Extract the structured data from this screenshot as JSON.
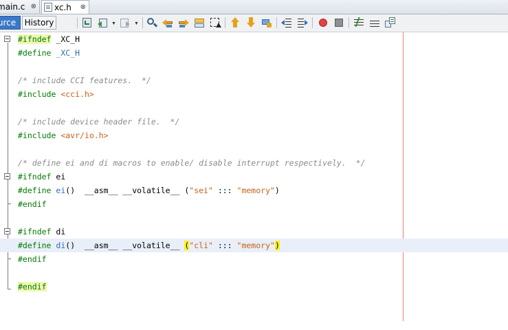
{
  "tabs": [
    {
      "label": "main.c",
      "active": false,
      "close": "⊗"
    },
    {
      "label": "xc.h",
      "active": true,
      "close": "⊗"
    }
  ],
  "toolbar": {
    "source_label": "Source",
    "source_visible": "urce",
    "history_label": "History",
    "icons": [
      "last-edit-icon",
      "back-icon",
      "forward-icon",
      "find-icon",
      "find-previous-icon",
      "find-next-icon",
      "toggle-highlight-icon",
      "toggle-rectangular-selection-icon",
      "previous-bookmark-icon",
      "next-bookmark-icon",
      "toggle-bookmark-icon",
      "shift-left-icon",
      "shift-right-icon",
      "record-macro-icon",
      "stop-macro-icon",
      "comment-icon",
      "uncomment-icon",
      "diff-icon"
    ]
  },
  "code": {
    "l1": {
      "kw": "#ifndef",
      "rest": " _XC_H"
    },
    "l2": {
      "kw": "#define",
      "sp": " ",
      "mac": "_XC_H"
    },
    "l4": {
      "cm": "/* include CCI features.  */"
    },
    "l5": {
      "kw": "#include",
      "sp": " ",
      "str": "<cci.h>"
    },
    "l7": {
      "cm": "/* include device header file.  */"
    },
    "l8": {
      "kw": "#include",
      "sp": " ",
      "str": "<avr/io.h>"
    },
    "l10": {
      "cm": "/* define ei and di macros to enable/ disable interrupt respectively.  */"
    },
    "l11": {
      "kw": "#ifndef",
      "rest": " ei"
    },
    "l12": {
      "kw": "#define",
      "sp": " ",
      "mac": "ei",
      "mid": "()  __asm__ __volatile__ (",
      "s1": "\"sei\"",
      "sep": " ::: ",
      "s2": "\"memory\"",
      "end": ")"
    },
    "l13": {
      "kw": "#endif"
    },
    "l15": {
      "kw": "#ifndef",
      "rest": " di"
    },
    "l16": {
      "kw": "#define",
      "sp": " ",
      "mac": "di",
      "mid": "()  __asm__ __volatile__ ",
      "open": "(",
      "s1": "\"cli\"",
      "sep": " ::: ",
      "s2": "\"memory\"",
      "close": ")"
    },
    "l17": {
      "kw": "#endif"
    },
    "l19": {
      "kw": "#endif"
    }
  },
  "colors": {
    "keyword": "#007a00",
    "macro": "#2f6fba",
    "comment": "#8a8a8a",
    "string": "#c7621b",
    "bracket_match": "#fbf21a",
    "current_line": "#e9eff8",
    "margin_line": "#f07a7a"
  }
}
